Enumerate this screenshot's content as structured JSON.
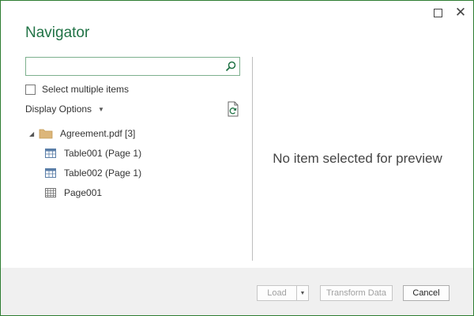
{
  "window": {
    "title": "Navigator",
    "maximize_label": "Maximize",
    "close_label": "Close"
  },
  "search": {
    "value": "",
    "placeholder": ""
  },
  "select_multiple": {
    "label": "Select multiple items",
    "checked": false
  },
  "display_options": {
    "label": "Display Options"
  },
  "tree": {
    "root": {
      "label": "Agreement.pdf [3]",
      "icon": "folder-icon",
      "expanded": true
    },
    "items": [
      {
        "label": "Table001 (Page 1)",
        "icon": "table-icon"
      },
      {
        "label": "Table002 (Page 1)",
        "icon": "table-icon"
      },
      {
        "label": "Page001",
        "icon": "page-grid-icon"
      }
    ]
  },
  "preview": {
    "message": "No item selected for preview"
  },
  "footer": {
    "load_label": "Load",
    "transform_label": "Transform Data",
    "cancel_label": "Cancel"
  },
  "colors": {
    "accent": "#217346",
    "window_border": "#2e7d32",
    "footer_bg": "#f0f0f0",
    "disabled_text": "#a0a0a0"
  }
}
